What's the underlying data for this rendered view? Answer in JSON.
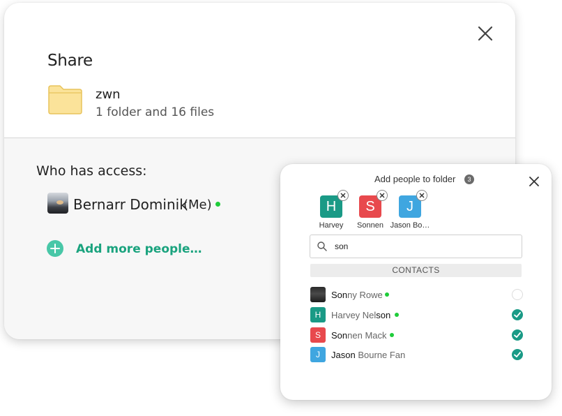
{
  "share": {
    "title": "Share",
    "folder": {
      "name": "zwn",
      "meta": "1 folder and 16 files"
    },
    "access_heading": "Who has access:",
    "owner": {
      "name": "Bernarr Dominik",
      "tag": "(Me)",
      "online": true
    },
    "add_more_label": "Add more people…",
    "icons": {
      "close": "close-icon",
      "folder": "folder-icon",
      "add": "plus-circle-icon"
    }
  },
  "popup": {
    "title": "Add people to folder",
    "count": "3",
    "selected": [
      {
        "initial": "H",
        "label": "Harvey",
        "color": "#1a9a86"
      },
      {
        "initial": "S",
        "label": "Sonnen",
        "color": "#e8494d"
      },
      {
        "initial": "J",
        "label": "Jason Bo…",
        "color": "#3fa6e0"
      }
    ],
    "search": {
      "value": "son",
      "placeholder": ""
    },
    "contacts_header": "CONTACTS",
    "contacts": [
      {
        "initial": "",
        "pre": "",
        "match": "Son",
        "post": "ny Rowe",
        "online": true,
        "selected": false,
        "color": "#333333"
      },
      {
        "initial": "H",
        "pre": "Harvey Nel",
        "match": "son",
        "post": "",
        "online": true,
        "selected": true,
        "color": "#1a9a86"
      },
      {
        "initial": "S",
        "pre": "",
        "match": "Son",
        "post": "nen Mack",
        "online": true,
        "selected": true,
        "color": "#e8494d"
      },
      {
        "initial": "J",
        "pre": "",
        "match": "Jason",
        "post": " Bourne Fan",
        "online": false,
        "selected": true,
        "color": "#3fa6e0"
      }
    ]
  },
  "colors": {
    "accent": "#1aa37e",
    "online": "#1fcc3a",
    "folder": "#fde59a"
  }
}
